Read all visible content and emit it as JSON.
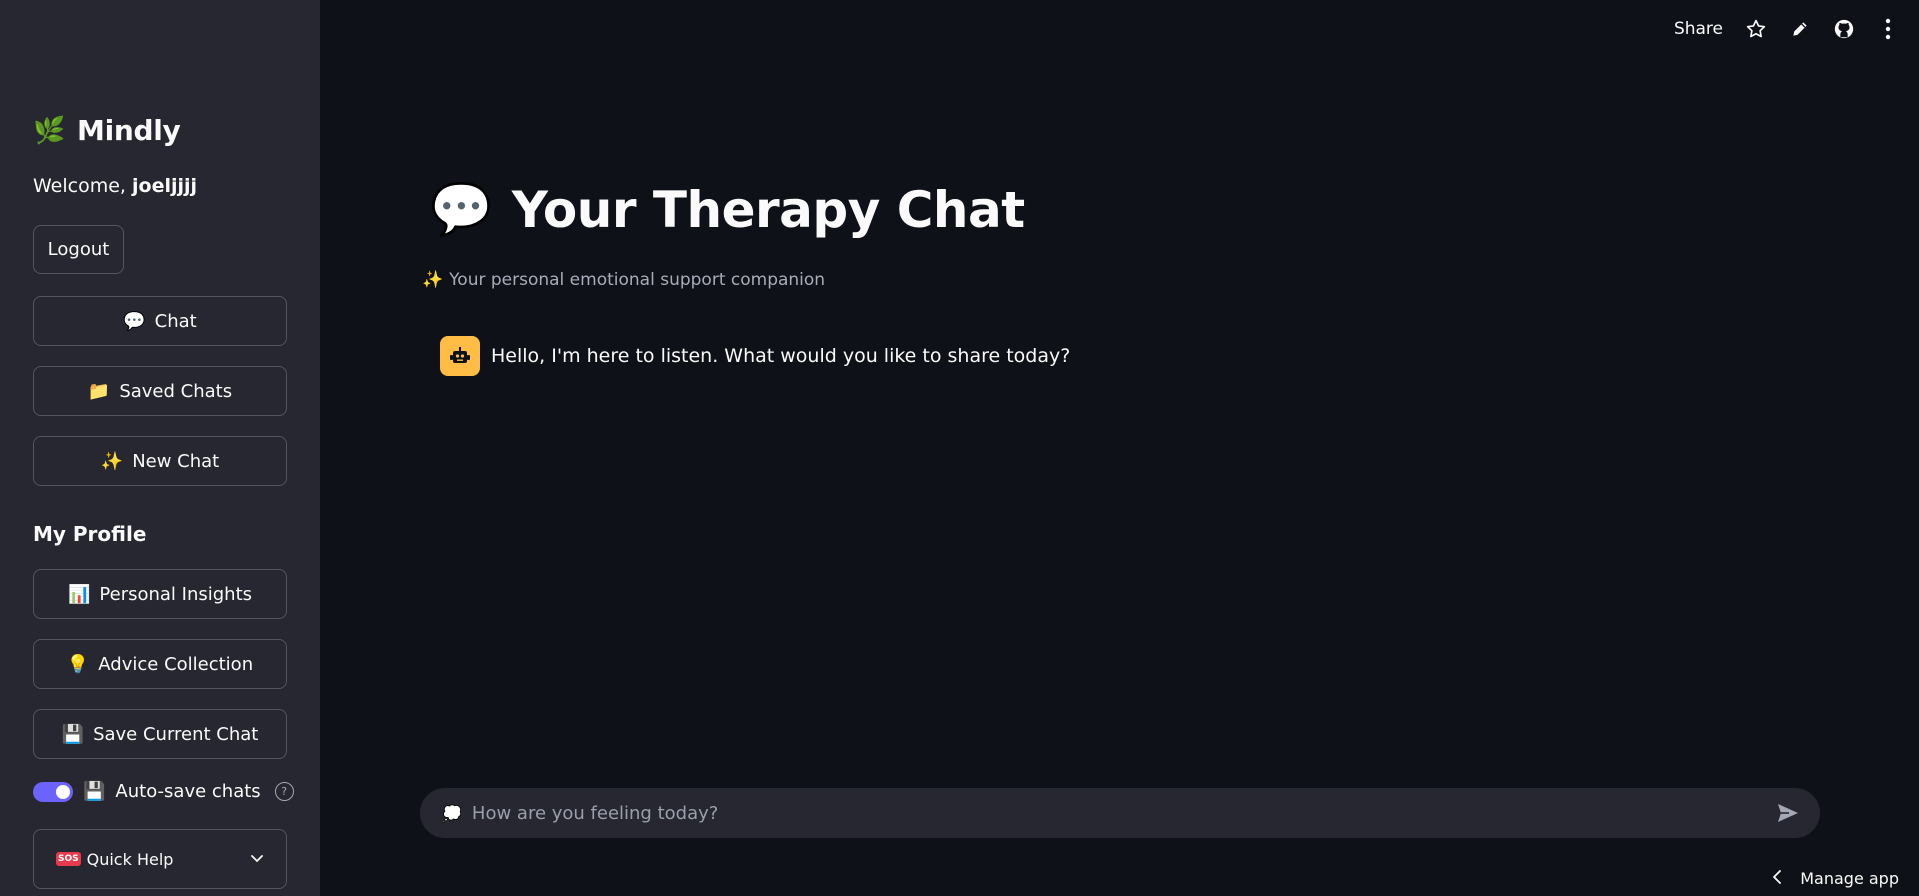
{
  "sidebar": {
    "brand": {
      "icon": "🌿",
      "name": "Mindly"
    },
    "welcome": {
      "prefix": "Welcome,",
      "username": "joeljjjj"
    },
    "logout_label": "Logout",
    "nav": [
      {
        "icon": "💬",
        "label": "Chat"
      },
      {
        "icon": "📁",
        "label": "Saved Chats"
      },
      {
        "icon": "✨",
        "label": "New Chat"
      }
    ],
    "profile_title": "My Profile",
    "profile_buttons": [
      {
        "icon": "📊",
        "label": "Personal Insights"
      },
      {
        "icon": "💡",
        "label": "Advice Collection"
      },
      {
        "icon": "💾",
        "label": "Save Current Chat"
      }
    ],
    "autosave": {
      "icon": "💾",
      "label": "Auto-save chats",
      "enabled": true,
      "help_glyph": "?"
    },
    "quick_help": {
      "badge": "SOS",
      "label": "Quick Help"
    }
  },
  "topbar": {
    "share_label": "Share",
    "icons": [
      "star-icon",
      "pencil-icon",
      "github-icon",
      "more-vertical-icon"
    ]
  },
  "main": {
    "title_icon": "💬",
    "title": "Your Therapy Chat",
    "subtitle_icon": "✨",
    "subtitle": "Your personal emotional support companion",
    "messages": [
      {
        "role": "assistant",
        "avatar": "robot-icon",
        "text": "Hello, I'm here to listen. What would you like to share today?"
      }
    ]
  },
  "chat_input": {
    "icon": "💭",
    "placeholder": "How are you feeling today?"
  },
  "footer": {
    "manage_label": "Manage app"
  },
  "colors": {
    "accent": "#6c63ff",
    "bot_avatar": "#ffbd45",
    "sidebar_bg": "#262730",
    "main_bg": "#0e1117"
  }
}
